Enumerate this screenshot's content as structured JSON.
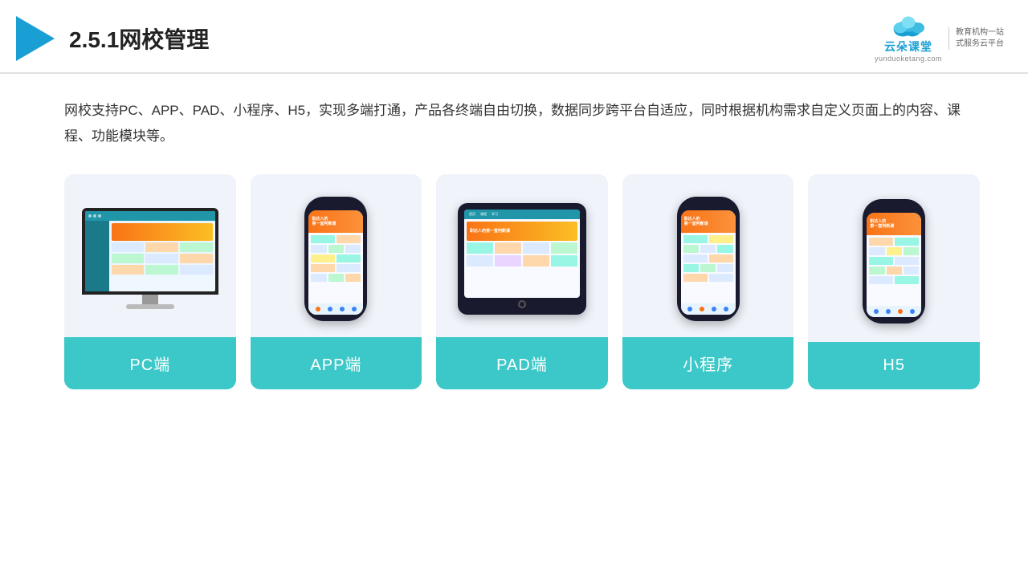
{
  "header": {
    "title": "2.5.1网校管理",
    "brand_main": "云朵课堂",
    "brand_url": "yunduoketang.com",
    "brand_slogan_line1": "教育机构一站",
    "brand_slogan_line2": "式服务云平台"
  },
  "description": "网校支持PC、APP、PAD、小程序、H5，实现多端打通，产品各终端自由切换，数据同步跨平台自适应，同时根据机构需求自定义页面上的内容、课程、功能模块等。",
  "cards": [
    {
      "id": "pc",
      "label": "PC端"
    },
    {
      "id": "app",
      "label": "APP端"
    },
    {
      "id": "pad",
      "label": "PAD端"
    },
    {
      "id": "miniprogram",
      "label": "小程序"
    },
    {
      "id": "h5",
      "label": "H5"
    }
  ],
  "colors": {
    "teal": "#3cc8c8",
    "accent": "#1a9fd4"
  }
}
